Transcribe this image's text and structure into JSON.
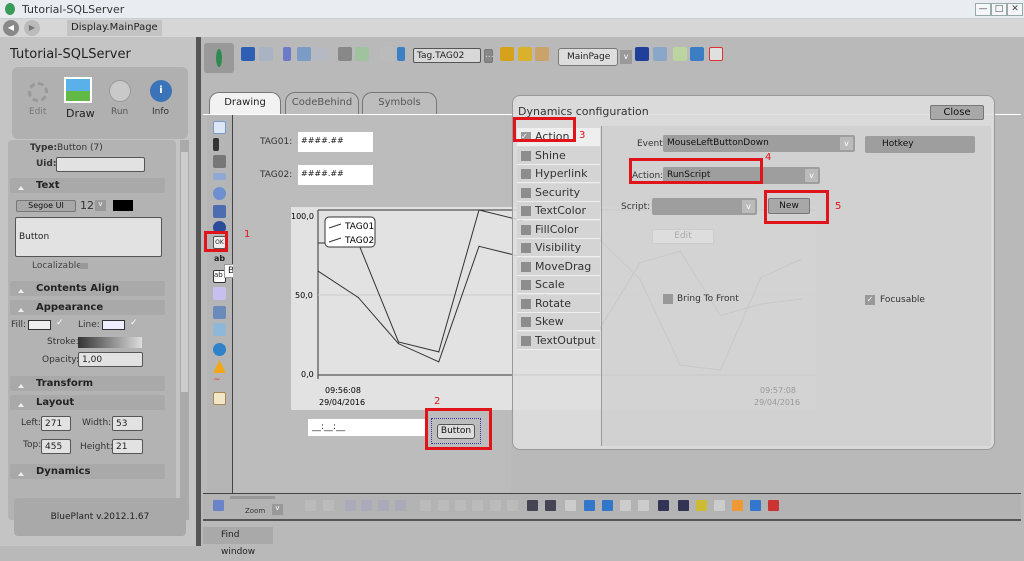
{
  "window": {
    "title": "Tutorial-SQLServer",
    "min": "—",
    "max": "□",
    "close": "✕"
  },
  "nav": {
    "back": "◀",
    "forward": "▶",
    "breadcrumb": "Display.MainPage"
  },
  "left": {
    "project_title": "Tutorial-SQLServer",
    "modes": [
      {
        "label": "Edit",
        "icon": "gear-icon"
      },
      {
        "label": "Draw",
        "icon": "image-icon"
      },
      {
        "label": "Run",
        "icon": "play-icon"
      },
      {
        "label": "Info",
        "icon": "info-icon"
      }
    ],
    "type_label": "Type:",
    "type_value": "Button (7)",
    "uid_label": "Uid:",
    "uid_value": "",
    "text_section": "Text",
    "font": "Segoe UI",
    "font_size": "12",
    "font_color": "#000000",
    "text_value": "Button",
    "localizable": "Localizable:",
    "contents_align": "Contents Align",
    "appearance": "Appearance",
    "fill": "Fill:",
    "line": "Line:",
    "stroke": "Stroke:",
    "opacity_label": "Opacity:",
    "opacity": "1,00",
    "transform": "Transform",
    "layout": "Layout",
    "left_label": "Left:",
    "left_value": "271",
    "width_label": "Width:",
    "width_value": "53",
    "top_label": "Top:",
    "top_value": "455",
    "height_label": "Height:",
    "height_value": "21",
    "dynamics": "Dynamics",
    "version": "BluePlant  v.2012.1.67"
  },
  "toolbar": {
    "tag_field": "Tag.TAG02",
    "more": "...",
    "page_select": "MainPage"
  },
  "tabs": [
    {
      "label": "Drawing",
      "active": true
    },
    {
      "label": "CodeBehind"
    },
    {
      "label": "Symbols"
    }
  ],
  "canvas": {
    "tag01_label": "TAG01:",
    "tag01_value": "####.##",
    "tag02_label": "TAG02:",
    "tag02_value": "####.##",
    "date_field": "__:__:__",
    "button_label": "Button",
    "tooltip": "Button",
    "annotations": [
      "1",
      "2",
      "3",
      "4",
      "5"
    ]
  },
  "chart_data": {
    "type": "line",
    "y_ticks": [
      "100,0",
      "50,0",
      "0,0"
    ],
    "ylim": [
      0,
      100
    ],
    "x_labels": [
      {
        "time": "09:56:08",
        "date": "29/04/2016"
      },
      {
        "time": "09:57:08",
        "date": "29/04/2016"
      }
    ],
    "legend": [
      "TAG01",
      "TAG02"
    ],
    "series": [
      {
        "name": "TAG01",
        "values": [
          80,
          80,
          20,
          14,
          100,
          94,
          86,
          82,
          58,
          6,
          3,
          59,
          70
        ]
      },
      {
        "name": "TAG02",
        "values": [
          63,
          47,
          19,
          8,
          78,
          72,
          36,
          28,
          68,
          75,
          36,
          43,
          46
        ]
      }
    ]
  },
  "dialog": {
    "title": "Dynamics configuration",
    "close": "Close",
    "items": [
      {
        "label": "Action",
        "checked": true
      },
      {
        "label": "Shine"
      },
      {
        "label": "Hyperlink"
      },
      {
        "label": "Security"
      },
      {
        "label": "TextColor"
      },
      {
        "label": "FillColor"
      },
      {
        "label": "Visibility"
      },
      {
        "label": "MoveDrag"
      },
      {
        "label": "Scale"
      },
      {
        "label": "Rotate"
      },
      {
        "label": "Skew"
      },
      {
        "label": "TextOutput"
      }
    ],
    "event_label": "Event:",
    "event_value": "MouseLeftButtonDown",
    "hotkey": "Hotkey",
    "action_label": "Action:",
    "action_value": "RunScript",
    "script_label": "Script:",
    "script_value": "",
    "new": "New",
    "edit": "Edit",
    "bring_to_front": "Bring To Front",
    "focusable": "Focusable"
  },
  "bottom": {
    "zoom": "Zoom",
    "find_window": "Find window"
  },
  "colors": {
    "highlight": "#e0141b",
    "dialog_bg": "#dedede"
  }
}
